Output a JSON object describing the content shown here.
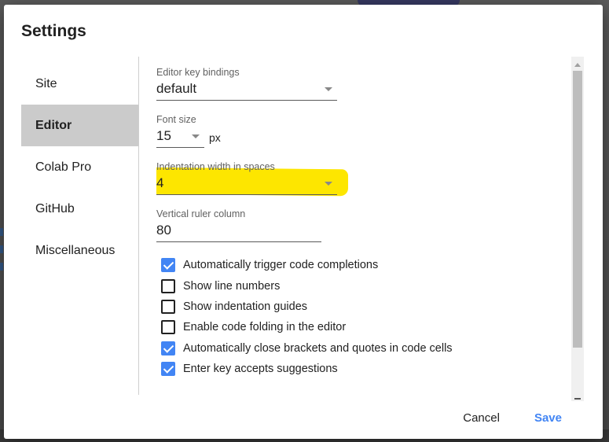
{
  "dialog": {
    "title": "Settings"
  },
  "sidebar": {
    "items": [
      {
        "label": "Site",
        "active": false
      },
      {
        "label": "Editor",
        "active": true
      },
      {
        "label": "Colab Pro",
        "active": false
      },
      {
        "label": "GitHub",
        "active": false
      },
      {
        "label": "Miscellaneous",
        "active": false
      }
    ]
  },
  "editor": {
    "key_bindings": {
      "label": "Editor key bindings",
      "value": "default"
    },
    "font_size": {
      "label": "Font size",
      "value": "15",
      "unit": "px"
    },
    "indentation": {
      "label": "Indentation width in spaces",
      "value": "4",
      "highlight_color": "#fde600"
    },
    "vertical_ruler": {
      "label": "Vertical ruler column",
      "value": "80"
    },
    "checkboxes": [
      {
        "label": "Automatically trigger code completions",
        "checked": true
      },
      {
        "label": "Show line numbers",
        "checked": false
      },
      {
        "label": "Show indentation guides",
        "checked": false
      },
      {
        "label": "Enable code folding in the editor",
        "checked": false
      },
      {
        "label": "Automatically close brackets and quotes in code cells",
        "checked": true
      },
      {
        "label": "Enter key accepts suggestions",
        "checked": true
      }
    ]
  },
  "actions": {
    "cancel_label": "Cancel",
    "save_label": "Save"
  },
  "colors": {
    "accent": "#4285f4",
    "active_nav_bg": "#cbcbcb"
  }
}
